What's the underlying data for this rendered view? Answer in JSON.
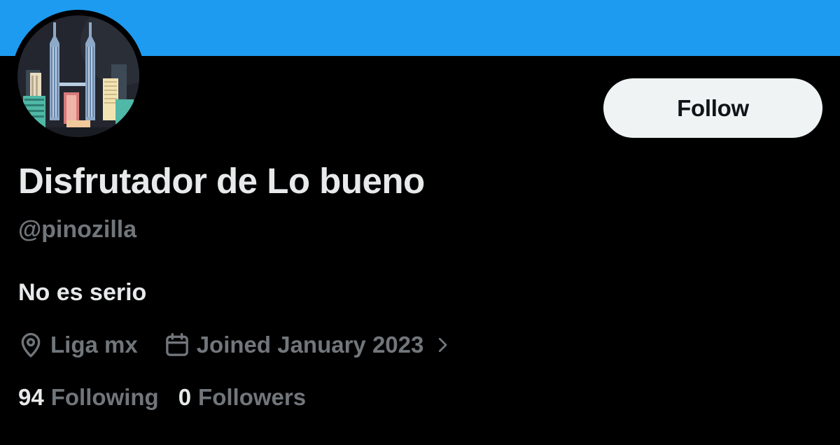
{
  "colors": {
    "banner": "#1d9bf0",
    "background": "#000000",
    "primary_text": "#e7e9ea",
    "secondary_text": "#71767b",
    "follow_button_bg": "#eff3f4",
    "follow_button_text": "#0f1419"
  },
  "profile": {
    "display_name": "Disfrutador de Lo bueno",
    "handle": "@pinozilla",
    "bio": "No es serio",
    "follow_label": "Follow"
  },
  "meta": {
    "location_icon": "location-pin-icon",
    "location": "Liga mx",
    "joined_icon": "calendar-icon",
    "joined": "Joined January 2023",
    "expand_icon": "chevron-right-icon"
  },
  "stats": {
    "following_count": "94",
    "following_label": "Following",
    "followers_count": "0",
    "followers_label": "Followers"
  }
}
